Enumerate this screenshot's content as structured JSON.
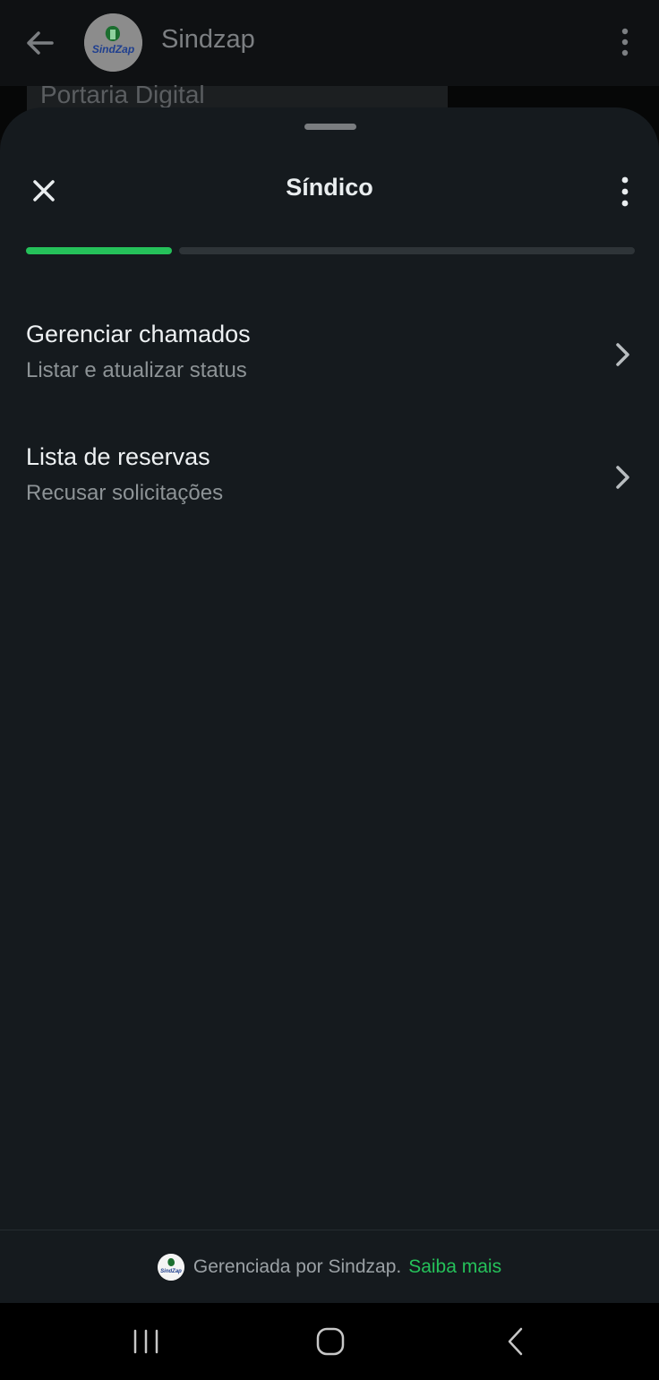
{
  "app_header": {
    "title": "Sindzap",
    "avatar_logo_text": "SindZap",
    "icons": [
      "back-arrow-icon",
      "more-vertical-icon"
    ]
  },
  "background_chat": {
    "bubble_text": "Portaria Digital"
  },
  "sheet": {
    "title": "Síndico",
    "progress": {
      "steps_total": 4,
      "current_step": 1,
      "completed_fraction": 0.24
    },
    "items": [
      {
        "title": "Gerenciar chamados",
        "subtitle": "Listar e atualizar status"
      },
      {
        "title": "Lista de reservas",
        "subtitle": "Recusar solicitações"
      }
    ],
    "footer": {
      "text": "Gerenciada por Sindzap.",
      "link": "Saiba mais",
      "logo_text": "SindZap"
    }
  },
  "colors": {
    "accent": "#25c15a",
    "sheet_background": "#151a1e",
    "text_primary": "#eef1f3",
    "text_secondary": "#8d9396"
  }
}
